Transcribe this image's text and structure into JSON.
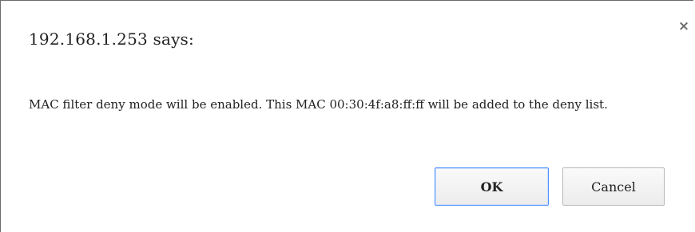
{
  "dialog": {
    "title": "192.168.1.253 says:",
    "message": "MAC filter deny mode will be enabled. This MAC 00:30:4f:a8:ff:ff will be added to the deny list.",
    "close_glyph": "×",
    "ok_label": "OK",
    "cancel_label": "Cancel"
  },
  "colors": {
    "primary_border": "#4d90fe",
    "text": "#222222",
    "close_icon": "#6e6e6e"
  },
  "icons": {
    "close": "close-icon"
  }
}
